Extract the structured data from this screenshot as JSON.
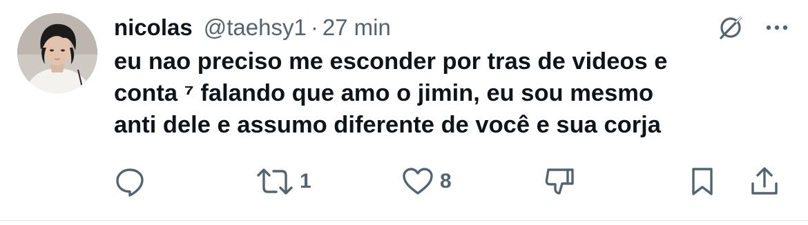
{
  "author": {
    "display_name": "nicolas",
    "handle": "@taehsy1",
    "separator": "·",
    "time": "27 min",
    "avatar_icon": "avatar-photo"
  },
  "tweet": {
    "lines": [
      "eu nao preciso me esconder por tras de videos e",
      "conta ⁷ falando que amo o jimin, eu sou mesmo",
      "anti dele e assumo diferente de você e sua corja"
    ]
  },
  "top_icons": {
    "grok": "grok-icon",
    "more": "more-icon"
  },
  "actions": {
    "reply": {
      "icon": "reply-icon",
      "count": ""
    },
    "retweet": {
      "icon": "retweet-icon",
      "count": "1"
    },
    "like": {
      "icon": "heart-icon",
      "count": "8"
    },
    "dislike": {
      "icon": "dislike-icon",
      "count": ""
    },
    "bookmark": {
      "icon": "bookmark-icon",
      "count": ""
    },
    "share": {
      "icon": "share-icon",
      "count": ""
    }
  },
  "colors": {
    "text": "#0f1419",
    "secondary": "#536471",
    "background": "#ffffff"
  }
}
